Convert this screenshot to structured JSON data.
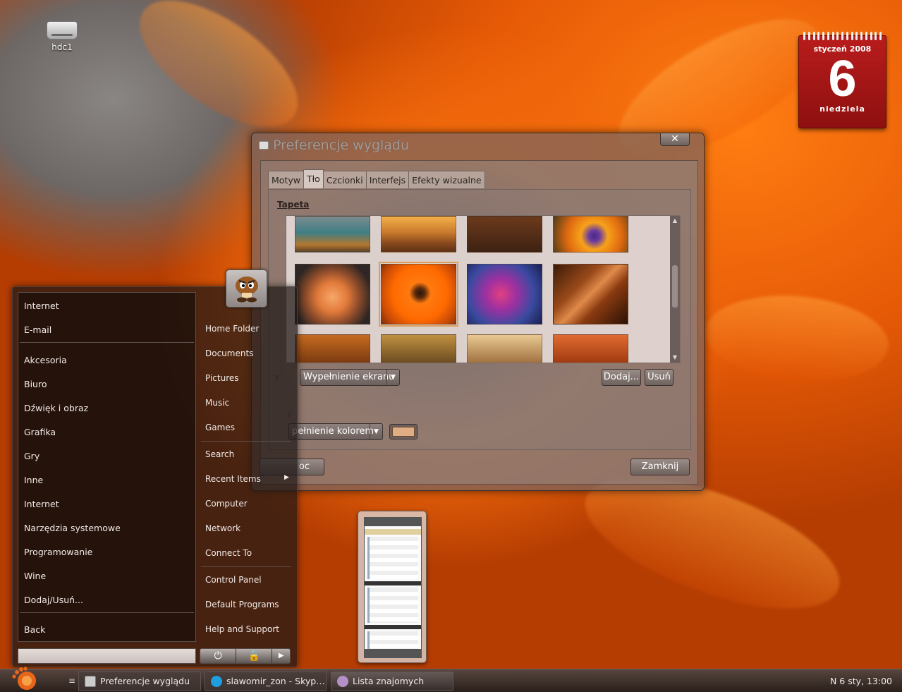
{
  "desktop": {
    "icons": [
      {
        "label": "hdc1",
        "icon": "harddisk-icon"
      }
    ],
    "wallpaper": "orange gerbera flower",
    "accent_color": "#f26a0c"
  },
  "calendar": {
    "month_year": "styczeń 2008",
    "day": "6",
    "weekday": "niedziela",
    "color": "#b91c1c"
  },
  "dialog": {
    "title": "Preferencje wyglądu",
    "close_label": "✕",
    "tabs": [
      {
        "label": "Motyw"
      },
      {
        "label": "Tło",
        "active": true
      },
      {
        "label": "Czcionki"
      },
      {
        "label": "Interfejs"
      },
      {
        "label": "Efekty wizualne"
      }
    ],
    "section_title": "Tapeta",
    "wallpapers_selected_index": 5,
    "style_label_partial": "y:",
    "style_value": "Wypełnienie ekranu",
    "add_button": "Dodaj...",
    "remove_button": "Usuń",
    "colors_label_partial": "y",
    "fill_value": "pełnienie kolorem",
    "fill_color": "#e0ae84",
    "help_button": "oc",
    "close_button": "Zamknij"
  },
  "start_menu": {
    "favorites": [
      "Internet",
      "E-mail"
    ],
    "categories": [
      "Akcesoria",
      "Biuro",
      "Dźwięk i obraz",
      "Grafika",
      "Gry",
      "Inne",
      "Internet",
      "Narzędzia systemowe",
      "Programowanie",
      "Wine",
      "Dodaj/Usuń..."
    ],
    "back_label": "Back",
    "places_group1": [
      "Home Folder",
      "Documents",
      "Pictures",
      "Music",
      "Games"
    ],
    "places_group2": [
      "Search",
      "Recent Items",
      "Computer",
      "Network",
      "Connect To"
    ],
    "places_group3": [
      "Control Panel",
      "Default Programs",
      "Help and Support"
    ],
    "search_placeholder": "",
    "power_icon": "power-icon",
    "lock_icon": "lock-icon",
    "arrow_icon": "arrow-right-icon"
  },
  "taskbar": {
    "handle": "≡",
    "tasks": [
      {
        "label": "Preferencje wyglądu",
        "icon": "appearance-icon"
      },
      {
        "label": "slawomir_zon - Skyp…",
        "icon": "skype-icon"
      },
      {
        "label": "Lista znajomych",
        "icon": "contacts-icon",
        "active": true
      }
    ],
    "tray_text": "N  6 sty, 13:00"
  }
}
